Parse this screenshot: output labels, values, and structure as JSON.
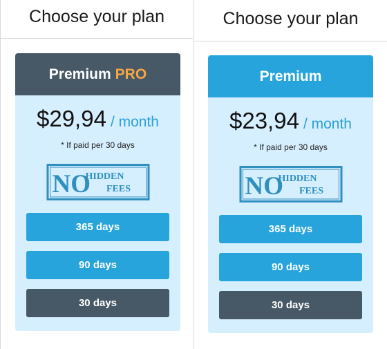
{
  "colors": {
    "accent_blue": "#27a4db",
    "header_dark": "#475966",
    "pro_orange": "#f7a644",
    "card_bg": "#d6efff",
    "price_unit": "#2a9fd6"
  },
  "plans": [
    {
      "heading": "Choose your plan",
      "title": "Premium",
      "title_suffix": "PRO",
      "header_style": "dark",
      "price": "$29,94",
      "period": "/ month",
      "note": "* If paid per 30 days",
      "badge": {
        "big": "NO",
        "line1": "HIDDEN",
        "line2": "FEES"
      },
      "options": [
        {
          "label": "365 days",
          "style": "blue"
        },
        {
          "label": "90 days",
          "style": "blue"
        },
        {
          "label": "30 days",
          "style": "dark"
        }
      ]
    },
    {
      "heading": "Choose your plan",
      "title": "Premium",
      "title_suffix": "",
      "header_style": "blue",
      "price": "$23,94",
      "period": "/ month",
      "note": "* If paid per 30 days",
      "badge": {
        "big": "NO",
        "line1": "HIDDEN",
        "line2": "FEES"
      },
      "options": [
        {
          "label": "365 days",
          "style": "blue"
        },
        {
          "label": "90 days",
          "style": "blue"
        },
        {
          "label": "30 days",
          "style": "dark"
        }
      ]
    }
  ]
}
